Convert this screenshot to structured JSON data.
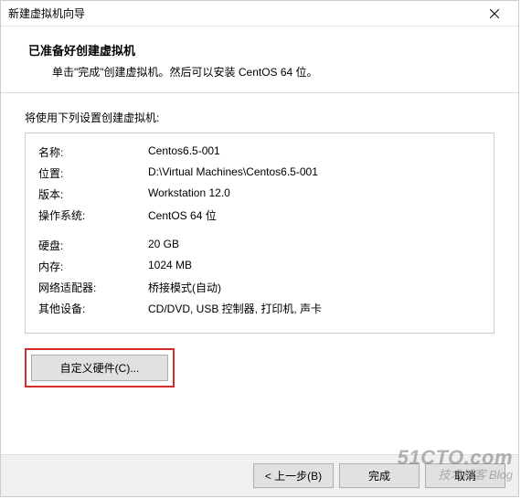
{
  "window": {
    "title": "新建虚拟机向导"
  },
  "header": {
    "title": "已准备好创建虚拟机",
    "description": "单击\"完成\"创建虚拟机。然后可以安装 CentOS 64 位。"
  },
  "summary": {
    "section_label": "将使用下列设置创建虚拟机:",
    "rows": [
      {
        "label": "名称:",
        "value": "Centos6.5-001"
      },
      {
        "label": "位置:",
        "value": "D:\\Virtual Machines\\Centos6.5-001"
      },
      {
        "label": "版本:",
        "value": "Workstation 12.0"
      },
      {
        "label": "操作系统:",
        "value": "CentOS 64 位"
      }
    ],
    "rows2": [
      {
        "label": "硬盘:",
        "value": "20 GB"
      },
      {
        "label": "内存:",
        "value": "1024 MB"
      },
      {
        "label": "网络适配器:",
        "value": "桥接模式(自动)"
      },
      {
        "label": "其他设备:",
        "value": "CD/DVD, USB 控制器, 打印机, 声卡"
      }
    ]
  },
  "buttons": {
    "customize": "自定义硬件(C)...",
    "back": "< 上一步(B)",
    "finish": "完成",
    "cancel": "取消"
  },
  "watermark": {
    "top": "51CTO.com",
    "bottom": "技术博客 Blog"
  }
}
